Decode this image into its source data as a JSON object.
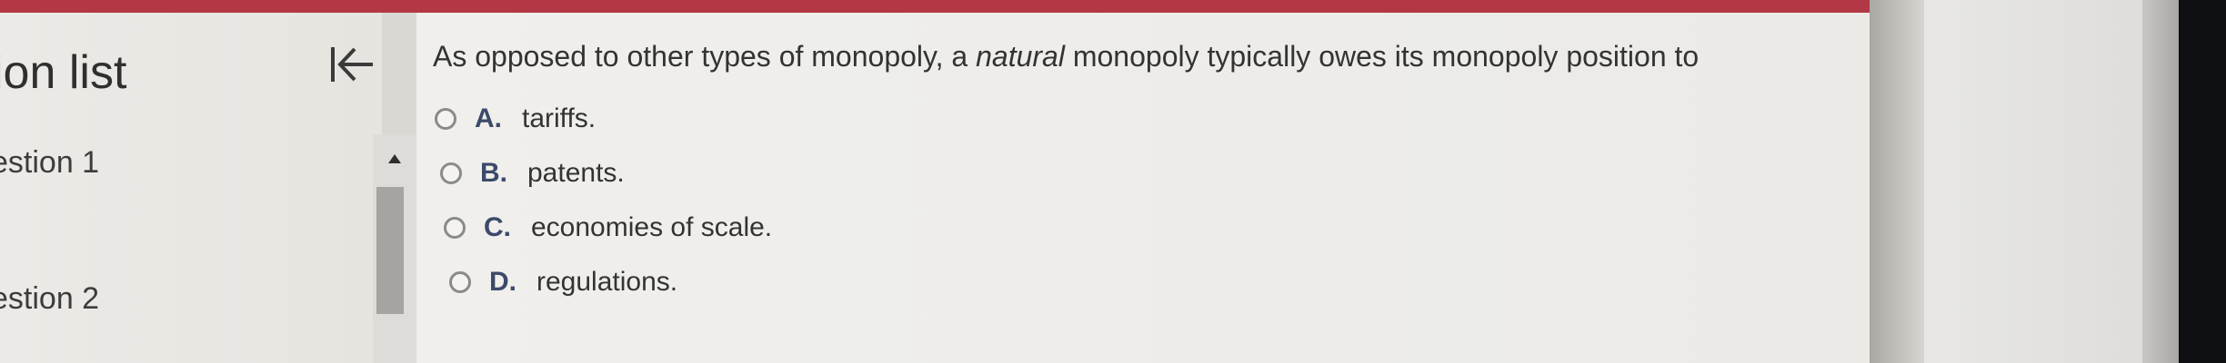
{
  "sidebar": {
    "title": "ion list",
    "items": [
      {
        "label": "estion 1"
      },
      {
        "label": "estion 2"
      }
    ]
  },
  "question": {
    "before": "As opposed to other types of monopoly, a ",
    "emphasis": "natural",
    "after": " monopoly typically owes its monopoly position to"
  },
  "options": [
    {
      "letter": "A.",
      "text": "tariffs."
    },
    {
      "letter": "B.",
      "text": "patents."
    },
    {
      "letter": "C.",
      "text": "economies of scale."
    },
    {
      "letter": "D.",
      "text": "regulations."
    }
  ],
  "colors": {
    "header_bar": "#b23845",
    "option_letter": "#3c4a6a"
  },
  "icons": {
    "collapse": "collapse-left-icon",
    "scroll_up": "triangle-up-icon"
  }
}
